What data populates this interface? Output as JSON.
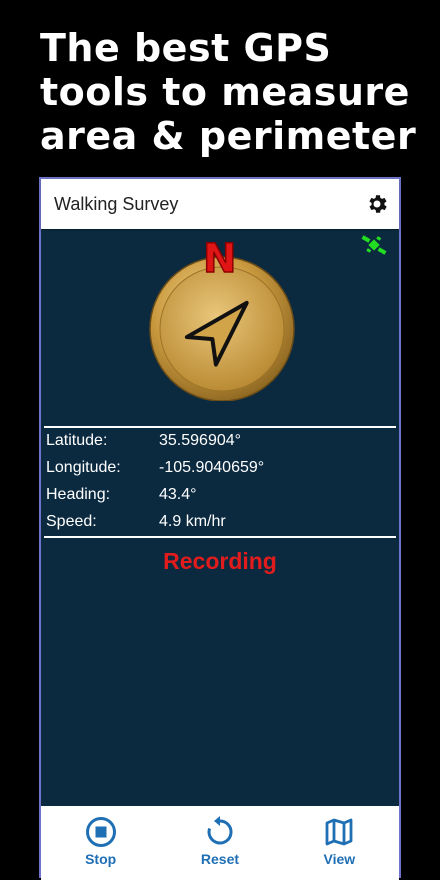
{
  "promo": {
    "line1": "The best GPS",
    "line2": "tools to measure",
    "line3": "area & perimeter"
  },
  "appbar": {
    "title": "Walking Survey",
    "settings_icon": "gear-icon"
  },
  "status_icon": "gps-satellite-icon",
  "compass": {
    "north_label": "N",
    "heading_deg": 43.4
  },
  "readings": {
    "latitude_label": "Latitude:",
    "latitude_value": "35.596904°",
    "longitude_label": "Longitude:",
    "longitude_value": "-105.9040659°",
    "heading_label": "Heading:",
    "heading_value": "43.4°",
    "speed_label": "Speed:",
    "speed_value": "4.9 km/hr"
  },
  "status_text": "Recording",
  "bottom_nav": {
    "stop_label": "Stop",
    "reset_label": "Reset",
    "view_label": "View"
  },
  "colors": {
    "panel_bg": "#0b2a40",
    "accent": "#1f6fb5",
    "recording": "#e21c1c",
    "gps_icon": "#22dd22"
  }
}
